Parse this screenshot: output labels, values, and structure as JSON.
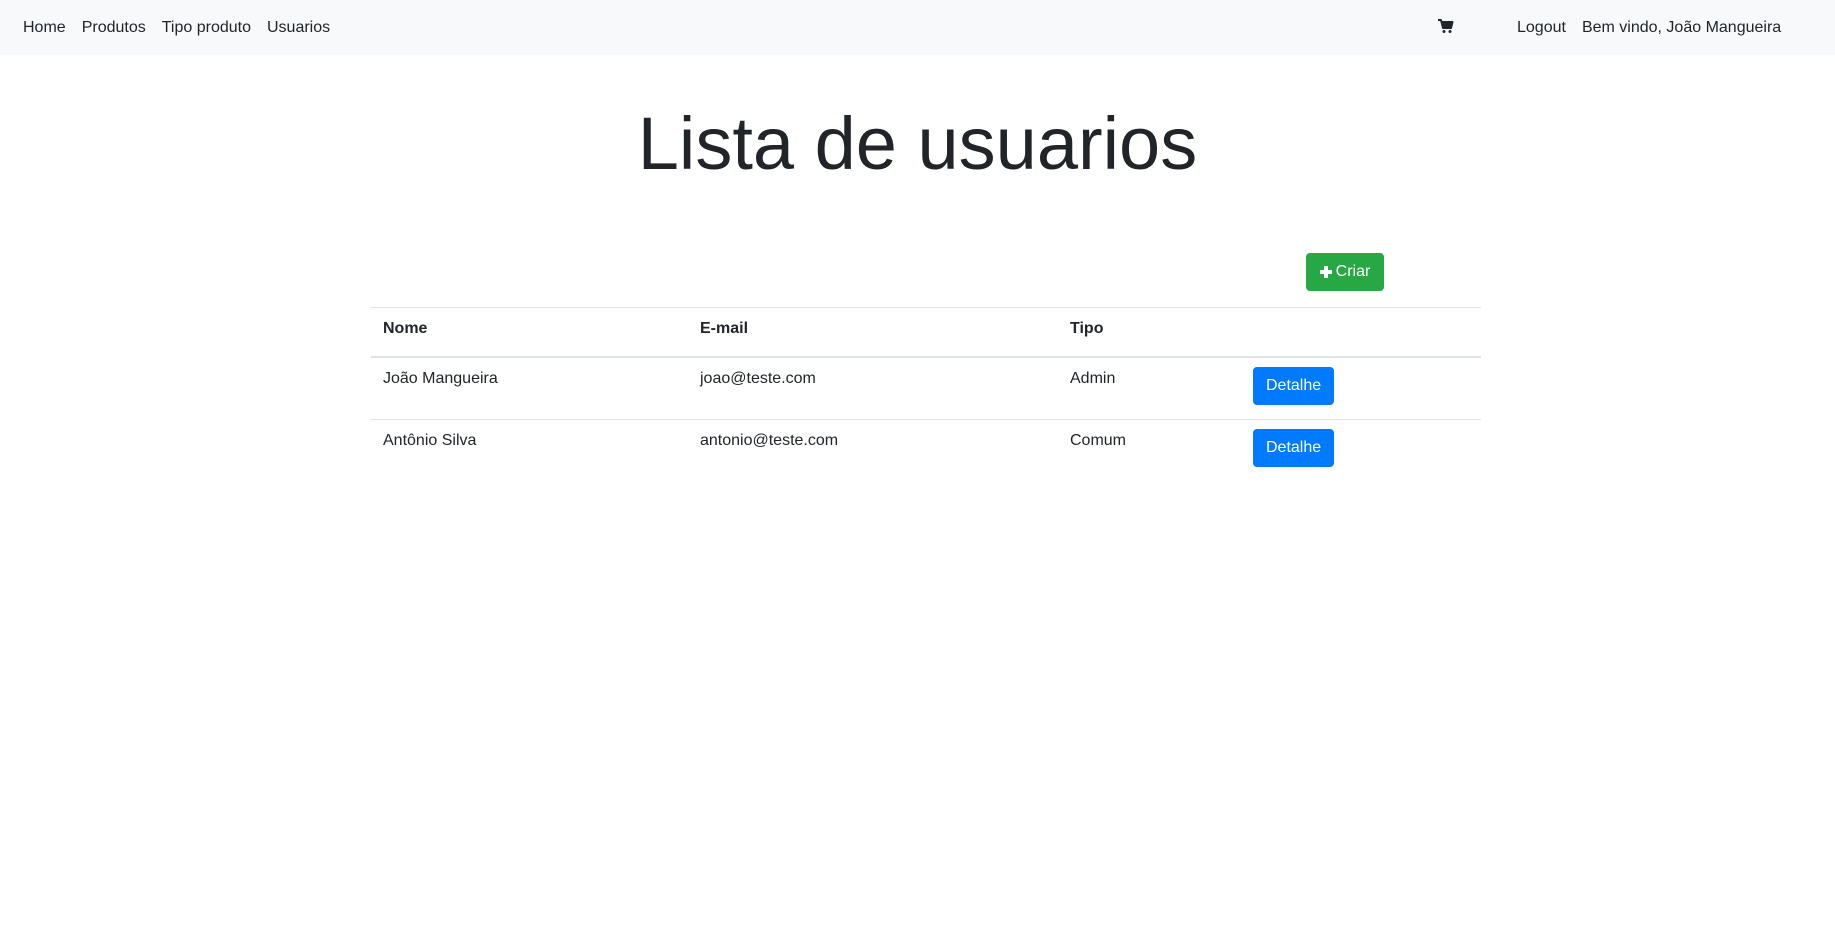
{
  "navbar": {
    "links": [
      "Home",
      "Produtos",
      "Tipo produto",
      "Usuarios"
    ],
    "cart_icon": "cart-icon",
    "logout_label": "Logout",
    "welcome_text": "Bem vindo, João Mangueira"
  },
  "page": {
    "title": "Lista de usuarios",
    "create_label": "Criar",
    "create_icon": "plus-icon",
    "create_color": "#28a745"
  },
  "table": {
    "headers": [
      "Nome",
      "E-mail",
      "Tipo",
      ""
    ],
    "rows": [
      {
        "nome": "João Mangueira",
        "email": "joao@teste.com",
        "tipo": "Admin",
        "action": "Detalhe"
      },
      {
        "nome": "Antônio Silva",
        "email": "antonio@teste.com",
        "tipo": "Comum",
        "action": "Detalhe"
      }
    ],
    "action_color": "#007bff"
  }
}
